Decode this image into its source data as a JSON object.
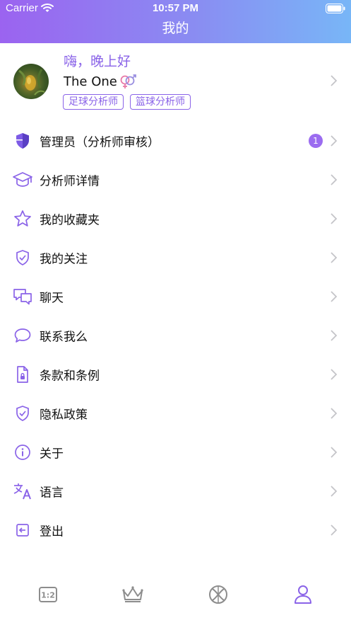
{
  "status_bar": {
    "carrier": "Carrier",
    "time": "10:57 PM"
  },
  "nav": {
    "title": "我的"
  },
  "profile": {
    "greeting": "嗨，晚上好",
    "username": "The One",
    "tags": [
      "足球分析师",
      "篮球分析师"
    ]
  },
  "menu": [
    {
      "label": "管理员（分析师审核）",
      "icon": "shield-icon",
      "badge": "1"
    },
    {
      "label": "分析师详情",
      "icon": "graduation-cap-icon"
    },
    {
      "label": "我的收藏夹",
      "icon": "star-icon"
    },
    {
      "label": "我的关注",
      "icon": "shield-check-icon"
    },
    {
      "label": "聊天",
      "icon": "chat-bubbles-icon"
    },
    {
      "label": "联系我么",
      "icon": "speech-bubble-icon"
    },
    {
      "label": "条款和条例",
      "icon": "document-lock-icon"
    },
    {
      "label": "隐私政策",
      "icon": "privacy-shield-icon"
    },
    {
      "label": "关于",
      "icon": "info-icon"
    },
    {
      "label": "语言",
      "icon": "translate-icon"
    },
    {
      "label": "登出",
      "icon": "logout-icon"
    }
  ],
  "tabbar": {
    "tabs": [
      "score-icon",
      "crown-icon",
      "globe-icon",
      "profile-icon"
    ],
    "active_index": 3
  },
  "colors": {
    "accent": "#8a63e8",
    "header_start": "#9b63f0",
    "header_end": "#78b6f7",
    "icon_gray": "#888888"
  }
}
